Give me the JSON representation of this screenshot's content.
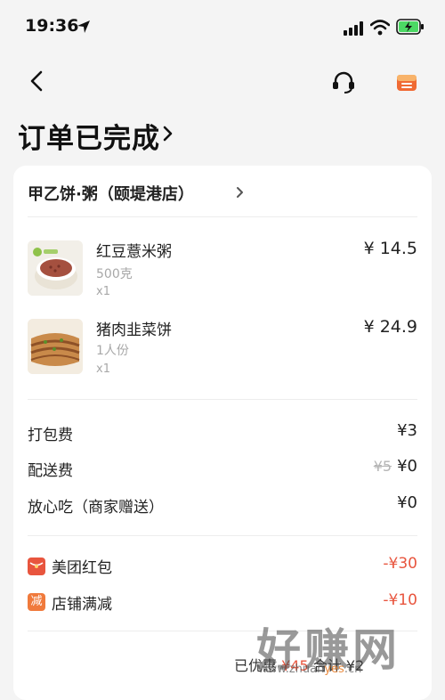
{
  "status": {
    "time": "19:36"
  },
  "order": {
    "title": "订单已完成"
  },
  "store": {
    "name": "甲乙饼·粥（颐堤港店）"
  },
  "items": [
    {
      "name": "红豆薏米粥",
      "spec": "500克",
      "qty": "x1",
      "price": "¥ 14.5"
    },
    {
      "name": "猪肉韭菜饼",
      "spec": "1人份",
      "qty": "x1",
      "price": "¥ 24.9"
    }
  ],
  "fees": [
    {
      "label": "打包费",
      "value": "¥3"
    },
    {
      "label": "配送费",
      "old": "¥5",
      "value": "¥0"
    },
    {
      "label": "放心吃（商家赠送）",
      "value": "¥0"
    }
  ],
  "discounts": [
    {
      "label": "美团红包",
      "value": "-¥30",
      "icon": "red-packet-icon",
      "color": "#e8553e"
    },
    {
      "label": "店铺满减",
      "value": "-¥10",
      "icon": "shop-discount-icon",
      "icon_text": "减",
      "color": "#f07a3c"
    }
  ],
  "summary": {
    "saved_label": "已优惠",
    "saved_value": "¥45",
    "total_label": "合计",
    "total_value": "¥2"
  },
  "watermark": {
    "text": "好赚网",
    "url_prefix": "www.zhuan",
    "url_highlight": "yes",
    "url_suffix": ".cn"
  }
}
